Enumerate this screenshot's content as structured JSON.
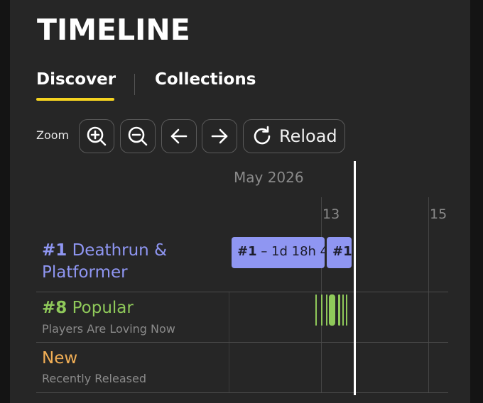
{
  "header": {
    "title": "TIMELINE"
  },
  "tabs": [
    {
      "label": "Discover",
      "active": true
    },
    {
      "label": "Collections",
      "active": false
    }
  ],
  "toolbar": {
    "zoom_label": "Zoom",
    "zoom_in_icon": "zoom-in-icon",
    "zoom_out_icon": "zoom-out-icon",
    "left_icon": "arrow-left-icon",
    "right_icon": "arrow-right-icon",
    "reload_icon": "reload-icon",
    "reload_label": "Reload"
  },
  "timeline": {
    "month_label": "May 2026",
    "ticks": [
      {
        "label": "13"
      },
      {
        "label": "15"
      }
    ],
    "rows": [
      {
        "rank": "#1",
        "title_line1": "Deathrun &",
        "title_line2": "Platformer",
        "subtitle": "",
        "color": "#8f96f2",
        "events": [
          {
            "rank": "#1",
            "text": " – 1d 18h 4"
          },
          {
            "rank": "#1",
            "text": ""
          }
        ]
      },
      {
        "rank": "#8",
        "title": "Popular",
        "subtitle": "Players Are Loving Now",
        "color": "#8fc95a"
      },
      {
        "rank": "",
        "title": "New",
        "subtitle": "Recently Released",
        "color": "#f1ae55"
      }
    ]
  },
  "colors": {
    "accent_underline": "#f5d320",
    "background": "#262626",
    "now_line": "#ffffff"
  }
}
